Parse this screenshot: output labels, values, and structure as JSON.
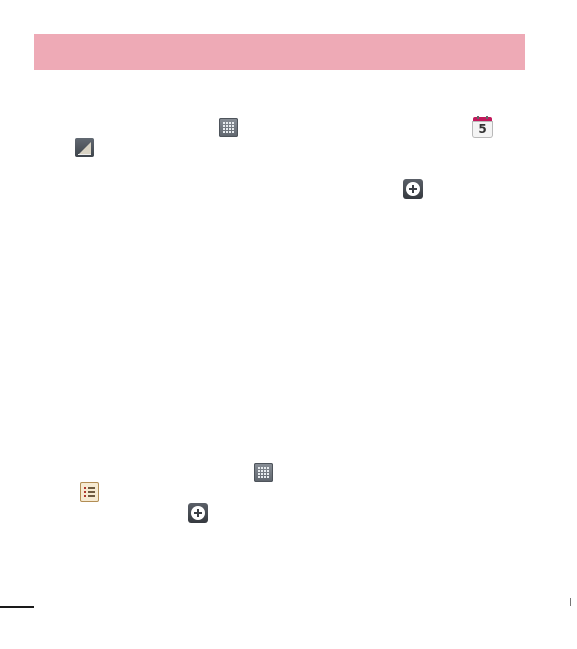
{
  "page": {
    "header_color": "#eeaab6",
    "icons": {
      "apps_1": "apps-grid-icon",
      "calendar": "calendar-icon",
      "calendar_day": "5",
      "edit": "edit-icon",
      "add_1": "add-plus-icon",
      "apps_2": "apps-grid-icon",
      "tasks": "tasks-checklist-icon",
      "add_2": "add-plus-icon"
    }
  }
}
